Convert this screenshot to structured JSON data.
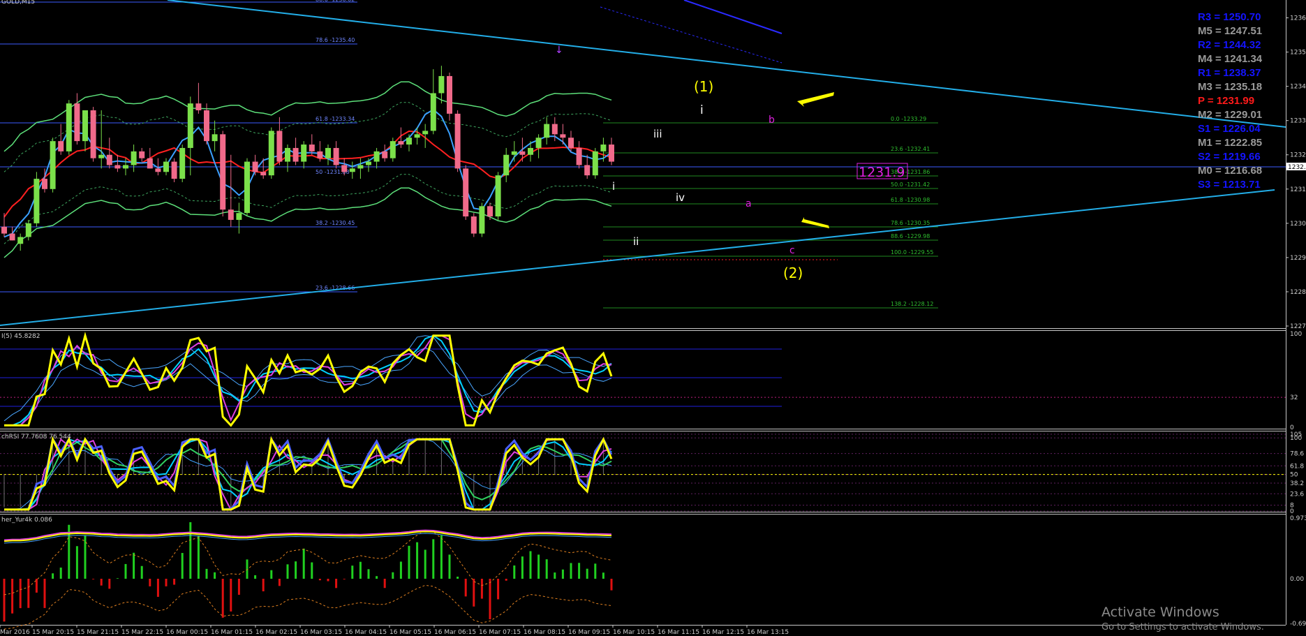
{
  "symbol": "GOLD,M15",
  "indicator_labels": {
    "rsi": "I(5) 45.8282",
    "stochrsi": "chRSI 77.7608 76.544",
    "fisher": "her_Yur4k 0.086"
  },
  "watermark": {
    "line1": "Activate Windows",
    "line2": "Go to Settings to activate Windows."
  },
  "pivots": [
    {
      "name": "R3",
      "value": "1250.70",
      "color": "#1414ff"
    },
    {
      "name": "M5",
      "value": "1247.51",
      "color": "#9a9a9a"
    },
    {
      "name": "R2",
      "value": "1244.32",
      "color": "#1414ff"
    },
    {
      "name": "M4",
      "value": "1241.34",
      "color": "#9a9a9a"
    },
    {
      "name": "R1",
      "value": "1238.37",
      "color": "#1414ff"
    },
    {
      "name": "M3",
      "value": "1235.18",
      "color": "#9a9a9a"
    },
    {
      "name": "P",
      "value": "1231.99",
      "color": "#ff1a1a"
    },
    {
      "name": "M2",
      "value": "1229.01",
      "color": "#9a9a9a"
    },
    {
      "name": "S1",
      "value": "1226.04",
      "color": "#1414ff"
    },
    {
      "name": "M1",
      "value": "1222.85",
      "color": "#9a9a9a"
    },
    {
      "name": "S2",
      "value": "1219.66",
      "color": "#1414ff"
    },
    {
      "name": "M0",
      "value": "1216.68",
      "color": "#9a9a9a"
    },
    {
      "name": "S3",
      "value": "1213.71",
      "color": "#1414ff"
    }
  ],
  "price_box": "1231.9",
  "current_price_tag": "1232.",
  "wave_labels": [
    "(1)",
    "(2)",
    "i",
    "ii",
    "iii",
    "iv",
    "i",
    "a",
    "b",
    "c"
  ],
  "fib_left": [
    "78.6 -1235.40",
    "61.8 -1233.34",
    "38.2 -1230.45",
    "23.6 -1228.66",
    "50 -1231.88",
    "88.6 -1236.62"
  ],
  "fib_right": [
    "0.0 -1233.29",
    "23.6 -1232.41",
    "38.2 -1231.86",
    "50.0 -1231.42",
    "61.8 -1230.98",
    "78.6 -1230.35",
    "88.6 -1229.98",
    "100.0 -1229.55",
    "138.2 -1228.12"
  ],
  "chart_data": {
    "type": "line",
    "title": "GOLD,M15",
    "price_axis": {
      "ticks": [
        "1236.",
        "1235.",
        "1234.",
        "1233.",
        "1232.",
        "1231.",
        "1230.",
        "1229.",
        "1228.",
        "1227."
      ],
      "range": [
        1226.9,
        1236.6
      ]
    },
    "time_axis": [
      "Mar 2016",
      "15 Mar 20:15",
      "15 Mar 21:15",
      "15 Mar 22:15",
      "16 Mar 00:15",
      "16 Mar 01:15",
      "16 Mar 02:15",
      "16 Mar 03:15",
      "16 Mar 04:15",
      "16 Mar 05:15",
      "16 Mar 06:15",
      "16 Mar 07:15",
      "16 Mar 08:15",
      "16 Mar 09:15",
      "16 Mar 10:15",
      "16 Mar 11:15",
      "16 Mar 12:15",
      "16 Mar 13:15"
    ],
    "candles": [
      [
        1229.9,
        1230.3,
        1229.6,
        1229.7
      ],
      [
        1229.7,
        1229.9,
        1229.5,
        1229.5
      ],
      [
        1229.4,
        1229.7,
        1229.2,
        1229.6
      ],
      [
        1229.6,
        1230.1,
        1229.5,
        1230.0
      ],
      [
        1230.0,
        1231.5,
        1229.9,
        1231.3
      ],
      [
        1231.3,
        1231.6,
        1230.9,
        1231.0
      ],
      [
        1231.0,
        1232.5,
        1230.9,
        1232.4
      ],
      [
        1232.4,
        1232.9,
        1232.0,
        1232.1
      ],
      [
        1232.1,
        1233.6,
        1232.0,
        1233.5
      ],
      [
        1233.5,
        1233.8,
        1232.3,
        1232.4
      ],
      [
        1232.4,
        1233.3,
        1232.1,
        1233.3
      ],
      [
        1233.3,
        1233.4,
        1231.8,
        1231.9
      ],
      [
        1231.9,
        1233.3,
        1231.6,
        1232.0
      ],
      [
        1232.0,
        1232.5,
        1231.6,
        1231.7
      ],
      [
        1231.7,
        1232.0,
        1231.5,
        1231.6
      ],
      [
        1231.6,
        1231.9,
        1231.4,
        1231.7
      ],
      [
        1231.7,
        1232.3,
        1231.5,
        1232.1
      ],
      [
        1232.1,
        1232.2,
        1231.8,
        1231.9
      ],
      [
        1231.9,
        1232.2,
        1231.6,
        1231.6
      ],
      [
        1231.6,
        1231.9,
        1231.4,
        1231.5
      ],
      [
        1231.5,
        1231.9,
        1231.4,
        1231.8
      ],
      [
        1231.8,
        1231.9,
        1231.2,
        1231.3
      ],
      [
        1231.3,
        1232.3,
        1231.2,
        1232.2
      ],
      [
        1232.2,
        1233.7,
        1231.4,
        1233.5
      ],
      [
        1233.5,
        1234.1,
        1233.2,
        1233.3
      ],
      [
        1233.3,
        1233.5,
        1232.3,
        1232.4
      ],
      [
        1232.4,
        1233.0,
        1232.1,
        1232.6
      ],
      [
        1232.6,
        1232.7,
        1230.2,
        1230.4
      ],
      [
        1230.4,
        1232.0,
        1229.9,
        1230.1
      ],
      [
        1230.1,
        1230.6,
        1229.7,
        1230.3
      ],
      [
        1230.3,
        1231.9,
        1230.2,
        1231.8
      ],
      [
        1231.8,
        1232.0,
        1231.4,
        1231.5
      ],
      [
        1231.5,
        1231.9,
        1231.3,
        1231.4
      ],
      [
        1231.4,
        1232.8,
        1231.3,
        1232.7
      ],
      [
        1232.7,
        1233.1,
        1231.7,
        1231.8
      ],
      [
        1231.8,
        1232.3,
        1231.5,
        1232.2
      ],
      [
        1232.2,
        1232.5,
        1231.7,
        1231.8
      ],
      [
        1231.8,
        1232.4,
        1231.6,
        1232.3
      ],
      [
        1232.3,
        1232.6,
        1232.0,
        1232.1
      ],
      [
        1232.1,
        1232.4,
        1231.8,
        1231.9
      ],
      [
        1231.9,
        1232.3,
        1231.7,
        1232.2
      ],
      [
        1232.2,
        1232.4,
        1231.6,
        1231.7
      ],
      [
        1231.7,
        1231.9,
        1231.4,
        1231.5
      ],
      [
        1231.5,
        1231.8,
        1231.3,
        1231.6
      ],
      [
        1231.6,
        1231.9,
        1231.3,
        1231.7
      ],
      [
        1231.7,
        1231.9,
        1231.5,
        1231.8
      ],
      [
        1231.8,
        1232.2,
        1231.6,
        1232.1
      ],
      [
        1232.1,
        1232.3,
        1231.8,
        1231.9
      ],
      [
        1231.9,
        1232.5,
        1231.8,
        1232.4
      ],
      [
        1232.4,
        1232.8,
        1232.2,
        1232.3
      ],
      [
        1232.3,
        1232.6,
        1232.1,
        1232.5
      ],
      [
        1232.5,
        1232.8,
        1232.3,
        1232.6
      ],
      [
        1232.6,
        1232.9,
        1232.2,
        1232.7
      ],
      [
        1232.7,
        1234.5,
        1232.6,
        1233.8
      ],
      [
        1233.8,
        1234.6,
        1233.5,
        1234.3
      ],
      [
        1234.3,
        1234.4,
        1233.0,
        1233.2
      ],
      [
        1233.2,
        1233.3,
        1231.5,
        1231.6
      ],
      [
        1231.6,
        1231.7,
        1230.1,
        1230.2
      ],
      [
        1230.2,
        1230.3,
        1229.6,
        1229.7
      ],
      [
        1229.7,
        1230.6,
        1229.6,
        1230.5
      ],
      [
        1230.5,
        1230.6,
        1230.1,
        1230.2
      ],
      [
        1230.2,
        1231.5,
        1230.1,
        1231.4
      ],
      [
        1231.4,
        1232.2,
        1231.2,
        1232.0
      ],
      [
        1232.0,
        1232.4,
        1231.8,
        1232.1
      ],
      [
        1232.1,
        1232.5,
        1231.8,
        1232.0
      ],
      [
        1232.0,
        1232.4,
        1231.8,
        1232.2
      ],
      [
        1232.2,
        1232.6,
        1231.9,
        1232.5
      ],
      [
        1232.5,
        1233.1,
        1232.3,
        1232.9
      ],
      [
        1232.9,
        1233.1,
        1232.4,
        1232.6
      ],
      [
        1232.6,
        1232.9,
        1232.3,
        1232.5
      ],
      [
        1232.5,
        1232.7,
        1232.1,
        1232.2
      ],
      [
        1232.2,
        1232.4,
        1231.6,
        1231.7
      ],
      [
        1231.7,
        1232.0,
        1231.3,
        1231.4
      ],
      [
        1231.4,
        1232.2,
        1231.3,
        1232.1
      ],
      [
        1232.1,
        1232.5,
        1231.8,
        1232.3
      ],
      [
        1232.3,
        1232.5,
        1231.7,
        1231.8
      ]
    ],
    "fib_right_levels": [
      1233.29,
      1232.41,
      1231.86,
      1231.42,
      1230.98,
      1230.35,
      1229.98,
      1229.55,
      1228.12
    ],
    "fib_left_levels": [
      1235.4,
      1233.34,
      1230.45,
      1228.66
    ],
    "rsi": {
      "axis": [
        "100",
        "32",
        "0"
      ],
      "levels": [
        32
      ]
    },
    "stochrsi": {
      "axis": [
        "105",
        "100",
        "78.6",
        "61.8",
        "50",
        "38.2",
        "23.6",
        "8",
        "0"
      ]
    },
    "fisher": {
      "axis": [
        "0.973",
        "0.00",
        "-0.694"
      ]
    }
  }
}
